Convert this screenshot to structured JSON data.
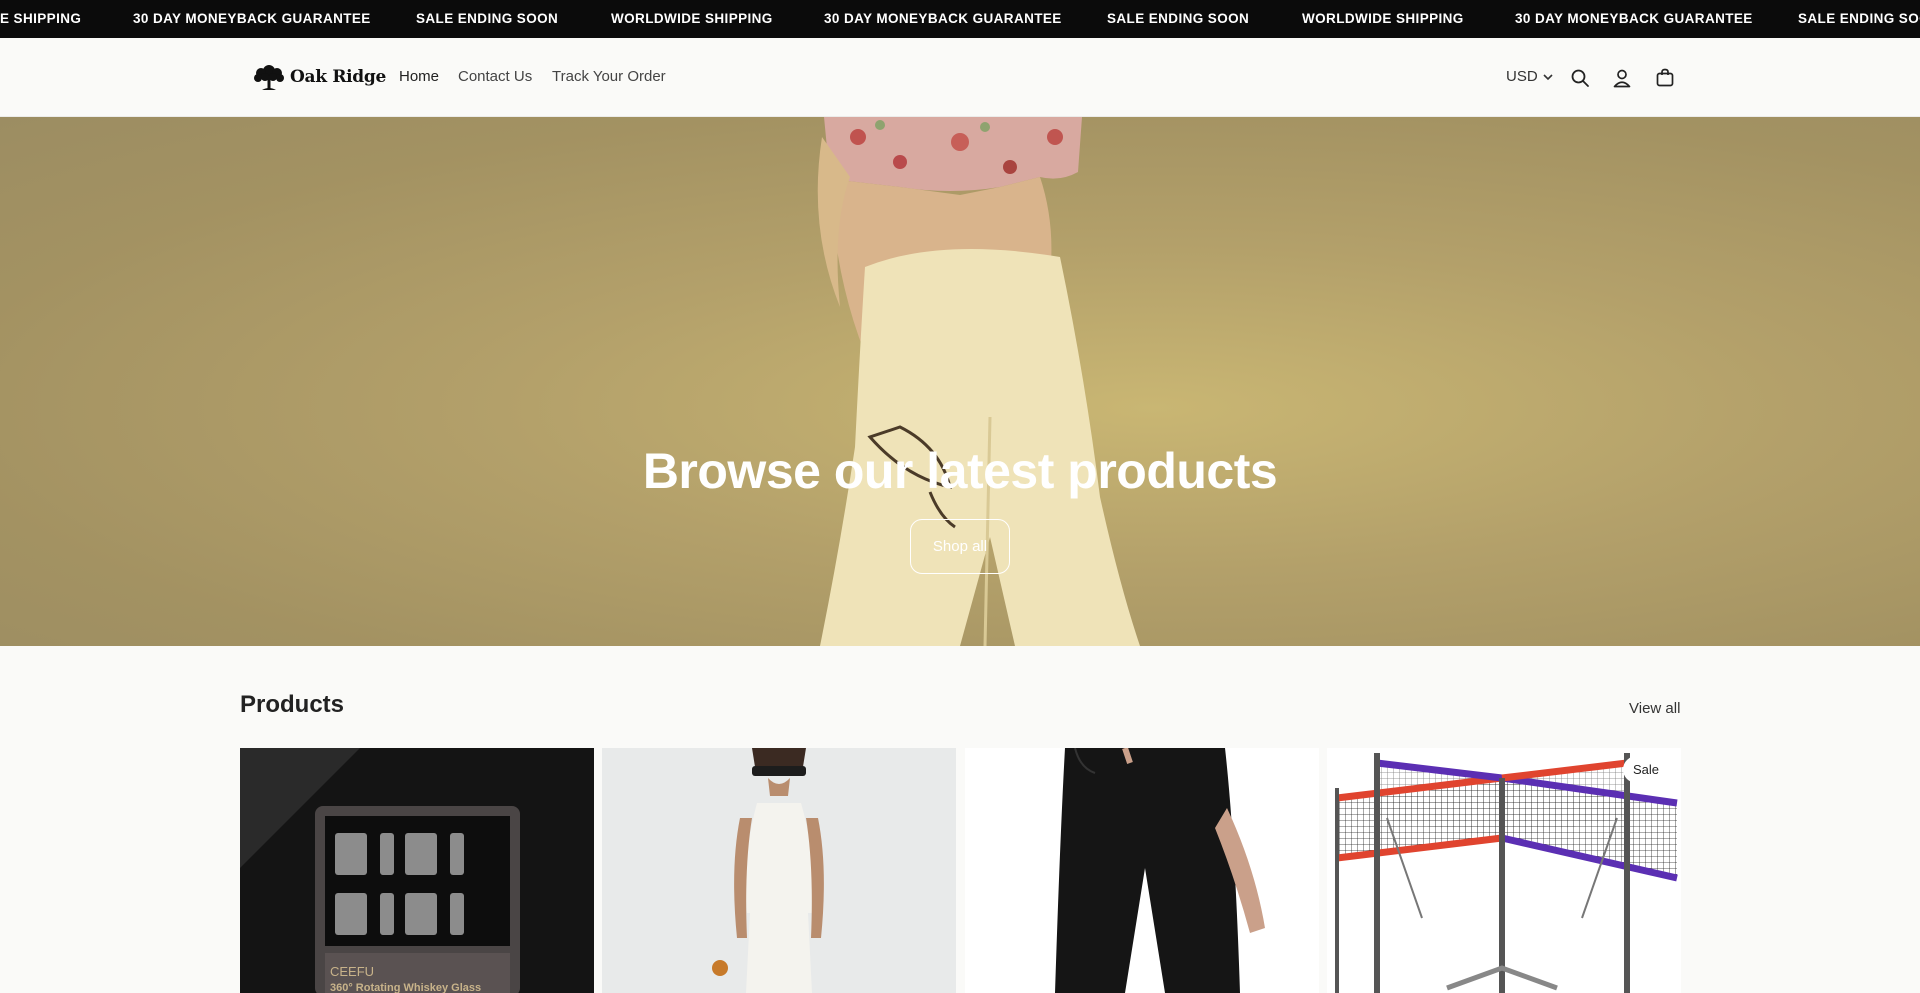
{
  "announcement": {
    "items": [
      "E SHIPPING",
      "30 DAY MONEYBACK GUARANTEE",
      "SALE ENDING SOON",
      "WORLDWIDE SHIPPING",
      "30 DAY MONEYBACK GUARANTEE",
      "SALE ENDING SOON",
      "WORLDWIDE SHIPPING",
      "30 DAY MONEYBACK GUARANTEE",
      "SALE ENDING SOO"
    ]
  },
  "header": {
    "logo_text": "Oak Ridge",
    "nav": [
      "Home",
      "Contact Us",
      "Track Your Order"
    ],
    "currency": "USD",
    "icons": [
      "search-icon",
      "account-icon",
      "cart-icon"
    ]
  },
  "hero": {
    "title": "Browse our latest products",
    "button_label": "Shop all"
  },
  "products": {
    "title": "Products",
    "view_all_label": "View all",
    "cards": [
      {
        "image_text_brand": "CEEFU",
        "image_text_caption": "360° Rotating Whiskey Glass",
        "badge": ""
      },
      {
        "badge": ""
      },
      {
        "badge": ""
      },
      {
        "badge": "Sale"
      }
    ]
  },
  "colors": {
    "announcement_bg": "#0b0b0b",
    "page_bg": "#fafaf8",
    "hero_bg": "#b3a06a"
  }
}
